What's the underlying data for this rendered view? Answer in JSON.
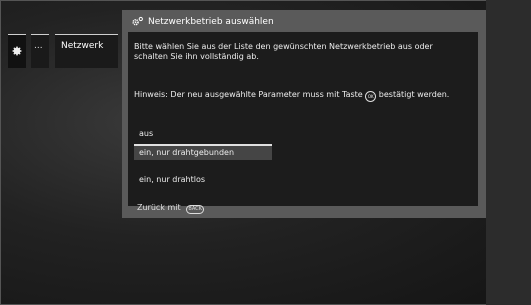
{
  "breadcrumb": {
    "dots_label": "...",
    "current_label": "Netzwerk"
  },
  "dialog": {
    "title": "Netzwerkbetrieb auswählen",
    "description": "Bitte wählen Sie aus der Liste den gewünschten Netzwerkbetrieb aus oder schalten Sie ihn vollständig ab.",
    "hint_before": "Hinweis: Der neu ausgewählte Parameter muss mit Taste",
    "hint_icon_label": "OK",
    "hint_after": "bestätigt werden.",
    "options": [
      {
        "label": "aus",
        "selected": false
      },
      {
        "label": "ein, nur drahtgebunden",
        "selected": true
      },
      {
        "label": "ein, nur drahtlos",
        "selected": false
      }
    ],
    "footer_label": "Zurück mit",
    "footer_icon_label": "BACK"
  },
  "icons": {
    "settings": "gear-icon",
    "ok_button": "ok-button-icon",
    "back_button": "back-button-icon"
  },
  "colors": {
    "dialog_frame": "#5a5a5a",
    "dialog_panel": "#1c1c1c",
    "selected_option": "#454545"
  }
}
